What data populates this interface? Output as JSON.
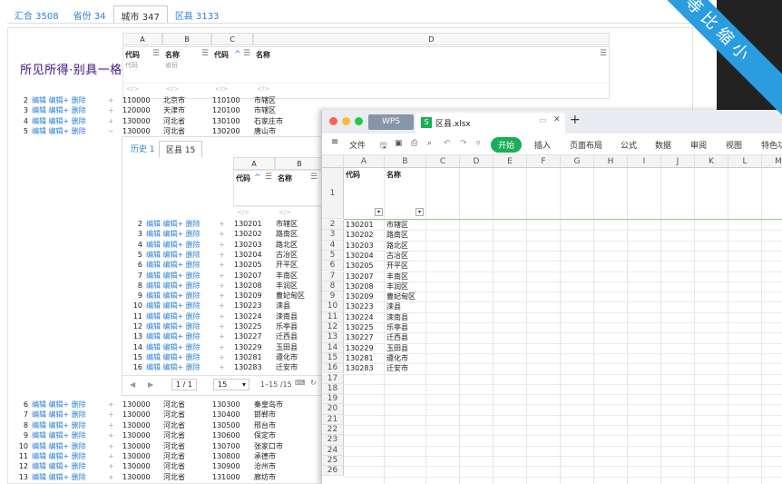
{
  "tabs": [
    {
      "label": "汇合 3508"
    },
    {
      "label": "省份 34"
    },
    {
      "label": "城市 347",
      "active": true
    },
    {
      "label": "区县 3133"
    }
  ],
  "ribbon": "等比缩小",
  "watermark": "所见所得·别具一格",
  "main_grid": {
    "col_letters": [
      "A",
      "B",
      "C",
      "D"
    ],
    "headers": [
      {
        "title": "代码",
        "sub": "代码"
      },
      {
        "title": "名称",
        "sub": "省份"
      },
      {
        "title": "代码"
      },
      {
        "title": "名称"
      }
    ],
    "filter_glyph": "</>",
    "actions": {
      "edit": "编辑",
      "edit_plus": "编辑+",
      "del": "删除"
    },
    "top_rows": [
      {
        "n": "2",
        "a": "110000",
        "b": "北京市",
        "c": "110100",
        "d": "市辖区",
        "sign": "+"
      },
      {
        "n": "3",
        "a": "120000",
        "b": "天津市",
        "c": "120100",
        "d": "市辖区",
        "sign": "+"
      },
      {
        "n": "4",
        "a": "130000",
        "b": "河北省",
        "c": "130100",
        "d": "石家庄市",
        "sign": "+"
      },
      {
        "n": "5",
        "a": "130000",
        "b": "河北省",
        "c": "130200",
        "d": "唐山市",
        "sign": "−"
      }
    ],
    "bottom_rows": [
      {
        "n": "6",
        "a": "130000",
        "b": "河北省",
        "c": "130300",
        "d": "秦皇岛市"
      },
      {
        "n": "7",
        "a": "130000",
        "b": "河北省",
        "c": "130400",
        "d": "邯郸市"
      },
      {
        "n": "8",
        "a": "130000",
        "b": "河北省",
        "c": "130500",
        "d": "邢台市"
      },
      {
        "n": "9",
        "a": "130000",
        "b": "河北省",
        "c": "130600",
        "d": "保定市"
      },
      {
        "n": "10",
        "a": "130000",
        "b": "河北省",
        "c": "130700",
        "d": "张家口市"
      },
      {
        "n": "11",
        "a": "130000",
        "b": "河北省",
        "c": "130800",
        "d": "承德市"
      },
      {
        "n": "12",
        "a": "130000",
        "b": "河北省",
        "c": "130900",
        "d": "沧州市"
      },
      {
        "n": "13",
        "a": "130000",
        "b": "河北省",
        "c": "131000",
        "d": "廊坊市"
      }
    ]
  },
  "sub_panel": {
    "tabs": [
      {
        "label": "历史 1"
      },
      {
        "label": "区县 15",
        "active": true
      }
    ],
    "col_letters": [
      "A",
      "B"
    ],
    "headers": [
      {
        "title": "代码"
      },
      {
        "title": "名称"
      }
    ],
    "rows": [
      {
        "n": "2",
        "a": "130201",
        "b": "市辖区"
      },
      {
        "n": "3",
        "a": "130202",
        "b": "路南区"
      },
      {
        "n": "4",
        "a": "130203",
        "b": "路北区"
      },
      {
        "n": "5",
        "a": "130204",
        "b": "古冶区"
      },
      {
        "n": "6",
        "a": "130205",
        "b": "开平区"
      },
      {
        "n": "7",
        "a": "130207",
        "b": "丰南区"
      },
      {
        "n": "8",
        "a": "130208",
        "b": "丰润区"
      },
      {
        "n": "9",
        "a": "130209",
        "b": "曹妃甸区"
      },
      {
        "n": "10",
        "a": "130223",
        "b": "滦县"
      },
      {
        "n": "11",
        "a": "130224",
        "b": "滦南县"
      },
      {
        "n": "12",
        "a": "130225",
        "b": "乐亭县"
      },
      {
        "n": "13",
        "a": "130227",
        "b": "迁西县"
      },
      {
        "n": "14",
        "a": "130229",
        "b": "玉田县"
      },
      {
        "n": "15",
        "a": "130281",
        "b": "遵化市"
      },
      {
        "n": "16",
        "a": "130283",
        "b": "迁安市"
      }
    ],
    "pager": {
      "page": "1",
      "sep": "/",
      "total": "1",
      "size": "15",
      "range": "1–15 /15"
    }
  },
  "wps": {
    "app_tab": "WPS",
    "file_tab": "区县.xlsx",
    "toolbar": [
      "文件",
      "开始",
      "插入",
      "页面布局",
      "公式",
      "数据",
      "审阅",
      "视图",
      "特色功"
    ],
    "start_label": "开始",
    "col_letters": [
      "A",
      "B",
      "C",
      "D",
      "E",
      "F",
      "G",
      "H",
      "I",
      "J",
      "K",
      "L",
      "M"
    ],
    "header_row": {
      "n": "1",
      "a": "代码",
      "b": "名称"
    },
    "rows": [
      {
        "n": "2",
        "a": "130201",
        "b": "市辖区"
      },
      {
        "n": "3",
        "a": "130202",
        "b": "路南区"
      },
      {
        "n": "4",
        "a": "130203",
        "b": "路北区"
      },
      {
        "n": "5",
        "a": "130204",
        "b": "古冶区"
      },
      {
        "n": "6",
        "a": "130205",
        "b": "开平区"
      },
      {
        "n": "7",
        "a": "130207",
        "b": "丰南区"
      },
      {
        "n": "8",
        "a": "130208",
        "b": "丰润区"
      },
      {
        "n": "9",
        "a": "130209",
        "b": "曹妃甸区"
      },
      {
        "n": "10",
        "a": "130223",
        "b": "滦县"
      },
      {
        "n": "11",
        "a": "130224",
        "b": "滦南县"
      },
      {
        "n": "12",
        "a": "130225",
        "b": "乐亭县"
      },
      {
        "n": "13",
        "a": "130227",
        "b": "迁西县"
      },
      {
        "n": "14",
        "a": "130229",
        "b": "玉田县"
      },
      {
        "n": "15",
        "a": "130281",
        "b": "遵化市"
      },
      {
        "n": "16",
        "a": "130283",
        "b": "迁安市"
      }
    ],
    "empty_rows": [
      "17",
      "18",
      "19",
      "20",
      "21",
      "22",
      "23",
      "24",
      "25",
      "26"
    ]
  }
}
